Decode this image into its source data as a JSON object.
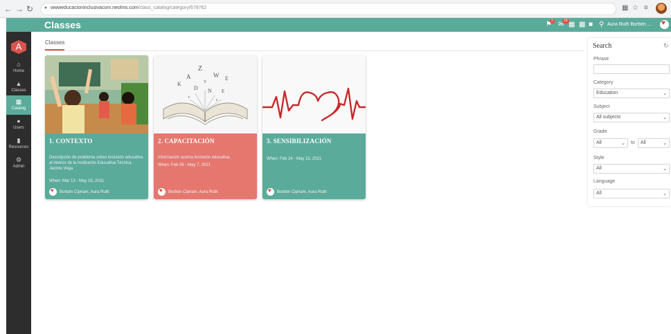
{
  "browser": {
    "back_icon": "back-arrow-icon",
    "forward_icon": "forward-arrow-icon",
    "reload_icon": "reload-icon",
    "url_host": "wwweducacioninclusivacom.neolms.com",
    "url_path": "/class_catalog/category/678762"
  },
  "header": {
    "title": "Classes",
    "notification_badge": "2",
    "message_badge": "19",
    "user_name": "Aura Ruth Borbón ..."
  },
  "sidebar": {
    "logo_letter": "A",
    "items": [
      {
        "label": "Home",
        "icon": "home-icon"
      },
      {
        "label": "Classes",
        "icon": "classes-icon"
      },
      {
        "label": "Catalog",
        "icon": "catalog-icon"
      },
      {
        "label": "Users",
        "icon": "users-icon"
      },
      {
        "label": "Resources",
        "icon": "resources-icon"
      },
      {
        "label": "Admin",
        "icon": "admin-icon"
      }
    ]
  },
  "main": {
    "breadcrumb": "Classes",
    "cards": [
      {
        "title": "1. CONTEXTO",
        "description": "Descripción de problema sobre inclusión educativa al interior de la Institución Educativa Técnica Jacinto Vega",
        "when": "When: Mar 13 - May 15, 2021",
        "author": "Borbón Cipriam, Aura Ruth",
        "color": "#5aab9a"
      },
      {
        "title": "2. CAPACITACIÓN",
        "description": "Información acerca inclusión educativa.",
        "when": "When: Feb 05 - May 7, 2021",
        "author": "Borbón Cipriam, Aura Ruth",
        "color": "#e5776f"
      },
      {
        "title": "3. SENSIBILIZACIÓN",
        "description": "",
        "when": "When: Feb 24 - May 15, 2021",
        "author": "Borbón Cipriam, Aura Ruth",
        "color": "#5aab9a"
      }
    ]
  },
  "search": {
    "title": "Search",
    "phrase_label": "Phrase",
    "phrase_value": "",
    "category_label": "Category",
    "category_value": "Education",
    "subject_label": "Subject",
    "subject_value": "All subjects",
    "grade_label": "Grade",
    "grade_from": "All",
    "grade_to_label": "to",
    "grade_to": "All",
    "style_label": "Style",
    "style_value": "All",
    "language_label": "Language",
    "language_value": "All"
  }
}
